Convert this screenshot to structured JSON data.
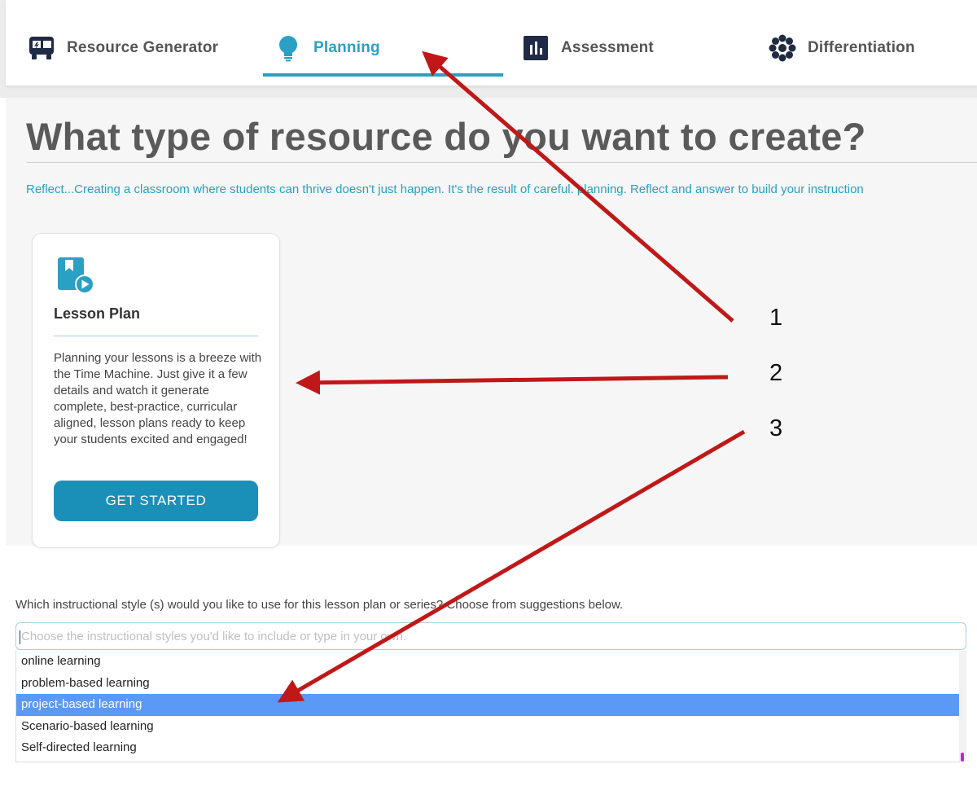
{
  "tabs": [
    {
      "label": "Resource Generator",
      "icon": "bus-icon",
      "active": false
    },
    {
      "label": "Planning",
      "icon": "lightbulb-icon",
      "active": true
    },
    {
      "label": "Assessment",
      "icon": "bar-chart-icon",
      "active": false
    },
    {
      "label": "Differentiation",
      "icon": "flower-icon",
      "active": false
    }
  ],
  "main": {
    "heading": "What type of resource do you want to create?",
    "reflect": "Reflect...Creating a classroom where students can thrive doesn't just happen. It's the result of careful. planning. Reflect and answer to build your instruction"
  },
  "card": {
    "icon": "bookmark-play-icon",
    "title": "Lesson Plan",
    "description": "Planning your lessons is a breeze with the Time Machine. Just give it a few details  and  watch it generate complete, best-practice, curricular aligned,  lesson plans ready to keep your students excited and engaged!",
    "button": "GET STARTED"
  },
  "form": {
    "question": "Which instructional style (s) would you like to use for this lesson plan or series?  Choose from suggestions below.",
    "placeholder": "Choose the instructional styles you'd like to include or type in your own.",
    "options": [
      "online learning",
      "problem-based learning",
      "project-based learning",
      "Scenario-based learning",
      "Self-directed learning"
    ],
    "selected_option": "project-based learning"
  },
  "annotations": [
    "1",
    "2",
    "3"
  ],
  "colors": {
    "accent": "#2aa0c4",
    "button": "#1a8fb8",
    "selected_option_bg": "#5b99f6",
    "arrow": "#c01818",
    "heading": "#5a5a5a",
    "icon_dark": "#1f2a44"
  }
}
